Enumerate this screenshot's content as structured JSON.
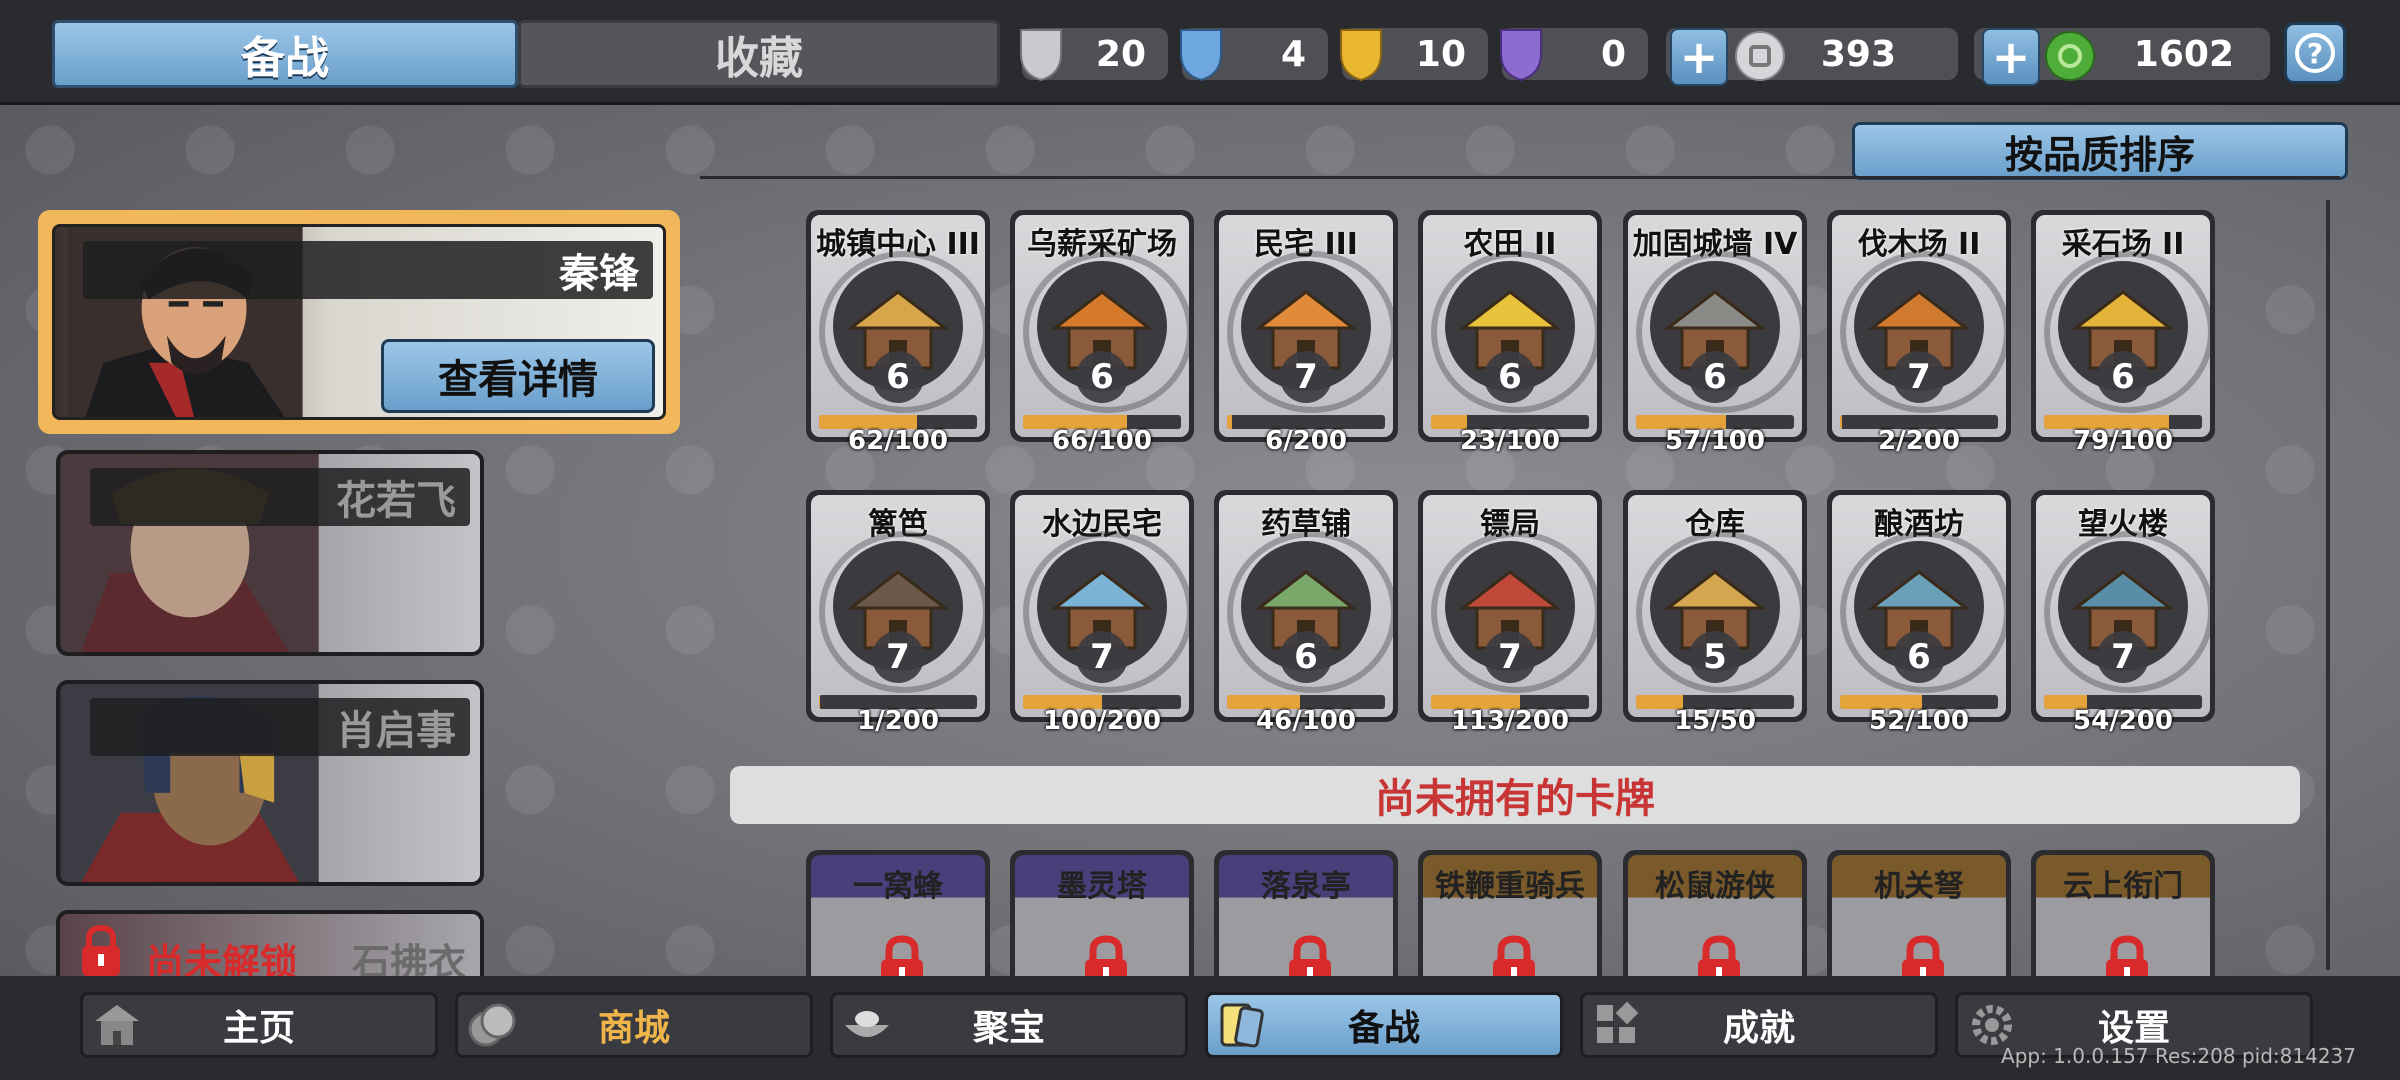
{
  "tabs": {
    "active": "备战",
    "inactive": "收藏"
  },
  "resources": [
    {
      "icon": "silver-shield-icon",
      "value": "20",
      "color": "#c9c9cf"
    },
    {
      "icon": "blue-shield-icon",
      "value": "4",
      "color": "#6fa7e0"
    },
    {
      "icon": "gold-shield-icon",
      "value": "10",
      "color": "#e8b630"
    },
    {
      "icon": "purple-shield-icon",
      "value": "0",
      "color": "#8e6bd0"
    }
  ],
  "currency": {
    "silver": "393",
    "jade": "1602"
  },
  "sort_button": "按品质排序",
  "heroes": {
    "selected": {
      "name": "秦锋",
      "detail_button": "查看详情"
    },
    "others": [
      "花若飞",
      "肖启事"
    ],
    "locked": {
      "status": "尚未解锁",
      "name": "石拂衣"
    }
  },
  "owned_cards": [
    {
      "name": "城镇中心 III",
      "level": "6",
      "progress": "62/100",
      "fill": 0.62,
      "art": "#d7a64a"
    },
    {
      "name": "乌薪采矿场",
      "level": "6",
      "progress": "66/100",
      "fill": 0.66,
      "art": "#d57a2a"
    },
    {
      "name": "民宅 III",
      "level": "7",
      "progress": "6/200",
      "fill": 0.03,
      "art": "#e08a3a"
    },
    {
      "name": "农田 II",
      "level": "6",
      "progress": "23/100",
      "fill": 0.23,
      "art": "#e8c23a"
    },
    {
      "name": "加固城墙 IV",
      "level": "6",
      "progress": "57/100",
      "fill": 0.57,
      "art": "#8a8a86"
    },
    {
      "name": "伐木场 II",
      "level": "7",
      "progress": "2/200",
      "fill": 0.01,
      "art": "#cf7a2e"
    },
    {
      "name": "采石场 II",
      "level": "6",
      "progress": "79/100",
      "fill": 0.79,
      "art": "#e4b33a"
    },
    {
      "name": "篱笆",
      "level": "7",
      "progress": "1/200",
      "fill": 0.005,
      "art": "#6b5a4a"
    },
    {
      "name": "水边民宅",
      "level": "7",
      "progress": "100/200",
      "fill": 0.5,
      "art": "#7ab3d6"
    },
    {
      "name": "药草铺",
      "level": "6",
      "progress": "46/100",
      "fill": 0.46,
      "art": "#7aa86a"
    },
    {
      "name": "镖局",
      "level": "7",
      "progress": "113/200",
      "fill": 0.565,
      "art": "#c04a3a"
    },
    {
      "name": "仓库",
      "level": "5",
      "progress": "15/50",
      "fill": 0.3,
      "art": "#d4a650"
    },
    {
      "name": "酿酒坊",
      "level": "6",
      "progress": "52/100",
      "fill": 0.52,
      "art": "#6aa0b8"
    },
    {
      "name": "望火楼",
      "level": "7",
      "progress": "54/200",
      "fill": 0.27,
      "art": "#5a8ea6"
    }
  ],
  "not_owned_banner": "尚未拥有的卡牌",
  "locked_cards": [
    {
      "name": "一窝蜂",
      "bg": "#4a3f7a"
    },
    {
      "name": "墨灵塔",
      "bg": "#4a3f7a"
    },
    {
      "name": "落泉亭",
      "bg": "#4a3f7a"
    },
    {
      "name": "铁鞭重骑兵",
      "bg": "#7a5a2a"
    },
    {
      "name": "松鼠游侠",
      "bg": "#7a5a2a"
    },
    {
      "name": "机关弩",
      "bg": "#7a5a2a"
    },
    {
      "name": "云上衔门",
      "bg": "#7a5a2a"
    }
  ],
  "nav": [
    {
      "label": "主页",
      "icon": "home-icon"
    },
    {
      "label": "商城",
      "icon": "shop-coins-icon"
    },
    {
      "label": "聚宝",
      "icon": "treasure-bowl-icon"
    },
    {
      "label": "备战",
      "icon": "cards-icon"
    },
    {
      "label": "成就",
      "icon": "achievement-grid-icon"
    },
    {
      "label": "设置",
      "icon": "gear-icon"
    }
  ],
  "version": "App: 1.0.0.157 Res:208 pid:814237"
}
